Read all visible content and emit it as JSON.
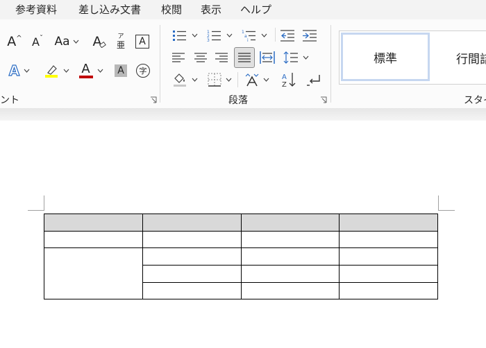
{
  "menu": {
    "items": [
      "参考資料",
      "差し込み文書",
      "校閲",
      "表示",
      "ヘルプ"
    ]
  },
  "ribbon": {
    "font_group_label": "ント",
    "paragraph_group_label": "段落",
    "styles_group_label": "スタイ",
    "font_buttons": {
      "grow_font": "A",
      "shrink_font": "A",
      "change_case": "Aa",
      "clear_format_glyph": "A",
      "phonetic_ruby": "ア",
      "phonetic_base": "亜",
      "char_border": "A",
      "text_effect": "A",
      "font_color": "A",
      "char_shading": "A",
      "enclose_char": "字"
    },
    "colors": {
      "accent_blue": "#2b6cc4",
      "highlight_yellow": "#ffff00",
      "font_color_red": "#c00000"
    },
    "styles": {
      "normal": "標準",
      "no_spacing": "行間詰"
    }
  },
  "table": {
    "rows": 5,
    "cols": 4,
    "header_fill": "#d9d9d9"
  }
}
